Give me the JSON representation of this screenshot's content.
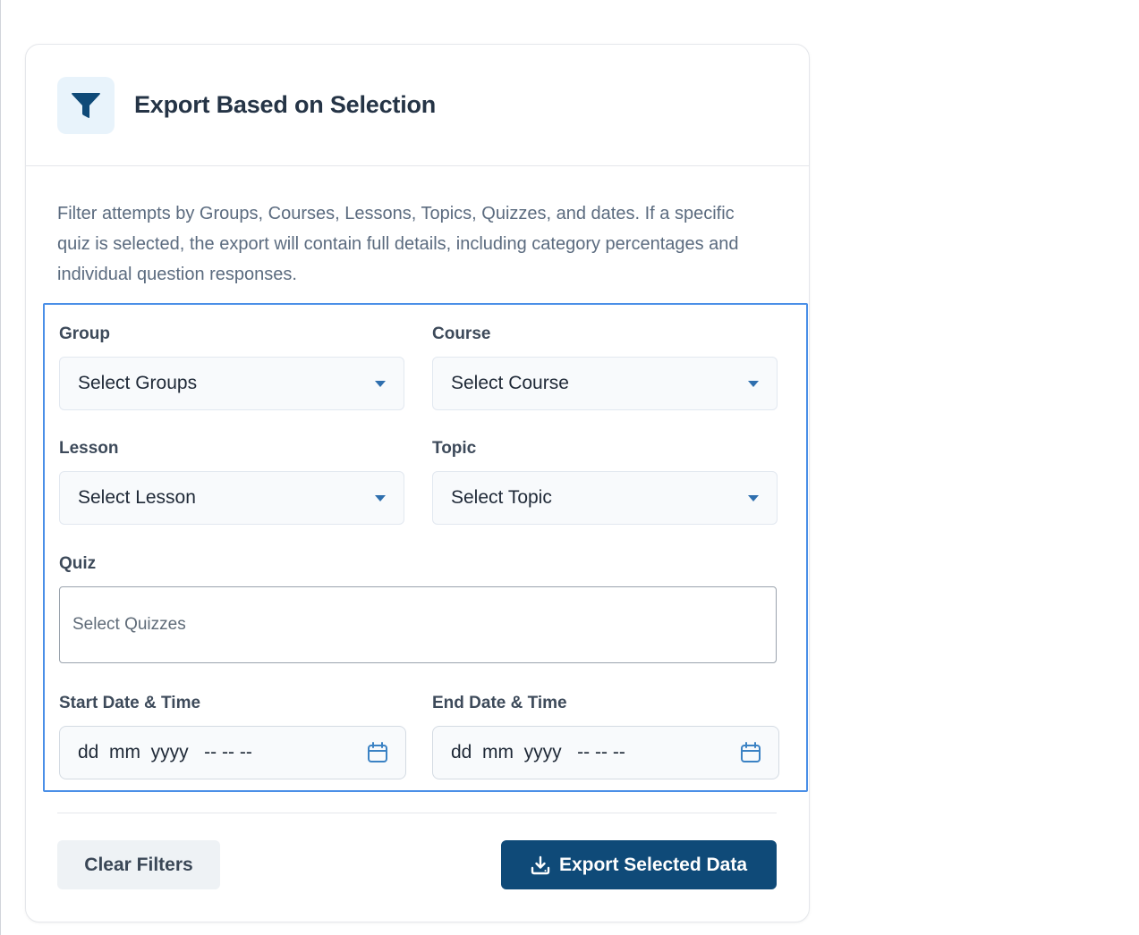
{
  "colors": {
    "accent": "#0f4a78",
    "focus_border": "#4a8fe7",
    "icon_bg": "#e8f3fb"
  },
  "header": {
    "icon": "filter-icon",
    "title": "Export Based on Selection"
  },
  "description": "Filter attempts by Groups, Courses, Lessons, Topics, Quizzes, and dates. If a specific quiz is selected, the export will contain full details, including category percentages and individual question responses.",
  "filters": {
    "group": {
      "label": "Group",
      "value": "Select Groups"
    },
    "course": {
      "label": "Course",
      "value": "Select Course"
    },
    "lesson": {
      "label": "Lesson",
      "value": "Select Lesson"
    },
    "topic": {
      "label": "Topic",
      "value": "Select Topic"
    },
    "quiz": {
      "label": "Quiz",
      "placeholder": "Select Quizzes"
    },
    "start_date": {
      "label": "Start Date & Time",
      "placeholder": "dd  mm  yyyy   -- -- --",
      "icon": "calendar-icon"
    },
    "end_date": {
      "label": "End Date & Time",
      "placeholder": "dd  mm  yyyy   -- -- --",
      "icon": "calendar-icon"
    }
  },
  "actions": {
    "clear_label": "Clear Filters",
    "export_label": "Export Selected Data",
    "export_icon": "download-icon"
  }
}
